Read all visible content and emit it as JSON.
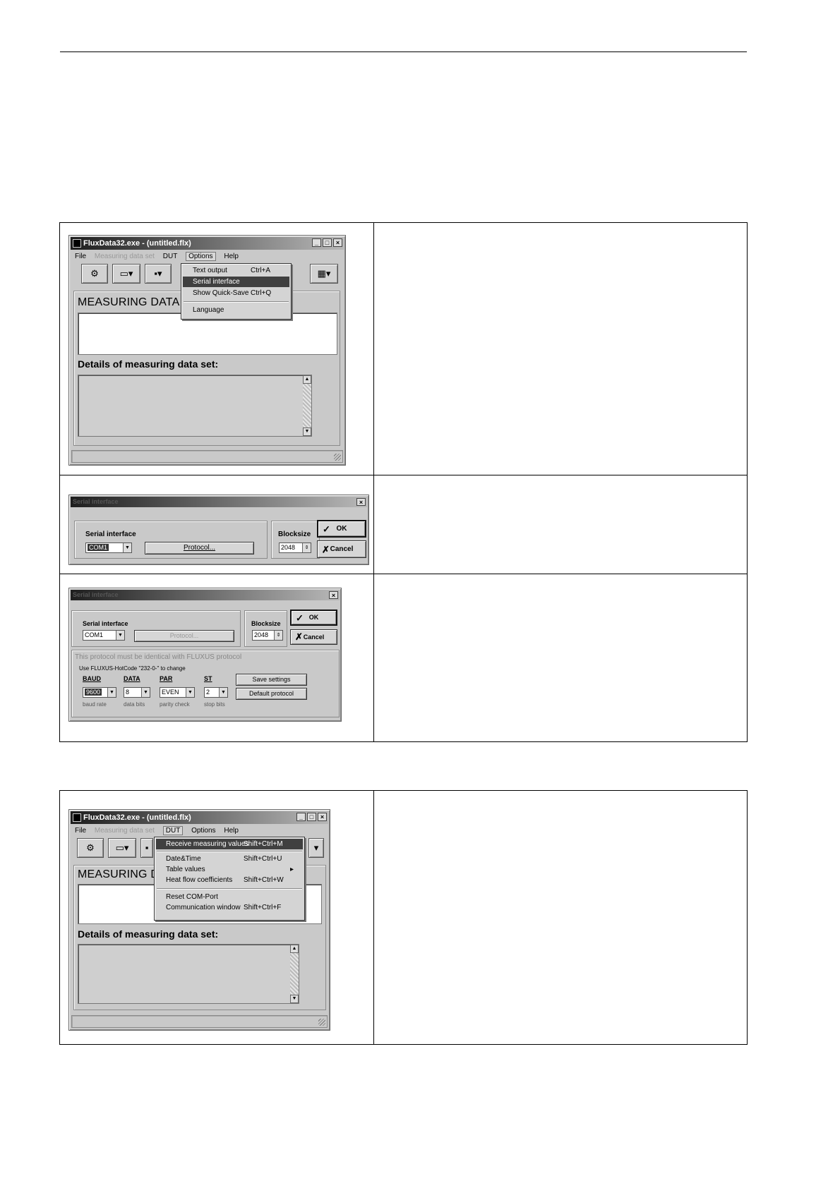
{
  "app1": {
    "title": "FluxData32.exe - (untitled.flx)",
    "menu": [
      "File",
      "Measuring data set",
      "DUT",
      "Options",
      "Help"
    ],
    "options_menu": [
      {
        "label": "Text output",
        "shortcut": "Ctrl+A"
      },
      {
        "label": "Serial interface",
        "shortcut": ""
      },
      {
        "label": "Show Quick-Save",
        "shortcut": "Ctrl+Q"
      },
      {
        "label": "Language",
        "shortcut": ""
      }
    ],
    "measuring_title": "MEASURING DATA S",
    "details_title": "Details of measuring data set:"
  },
  "serial1": {
    "title": "Serial interface",
    "group_label": "Serial interface",
    "port": "COM1",
    "protocol_button": "Protocol...",
    "blocksize_label": "Blocksize",
    "blocksize_value": "2048",
    "ok": "OK",
    "cancel": "Cancel"
  },
  "serial2": {
    "title": "Serial interface",
    "group_label": "Serial interface",
    "port": "COM1",
    "protocol_button": "Protocol...",
    "blocksize_label": "Blocksize",
    "blocksize_value": "2048",
    "ok": "OK",
    "cancel": "Cancel",
    "protocol_note": "This protocol must be identical with FLUXUS protocol",
    "hotcode_note": "Use FLUXUS-HotCode \"232-0-\" to change",
    "fields": [
      {
        "label": "BAUD",
        "value": "9600",
        "caption": "baud rate"
      },
      {
        "label": "DATA",
        "value": "8",
        "caption": "data bits"
      },
      {
        "label": "PAR",
        "value": "EVEN",
        "caption": "parity check"
      },
      {
        "label": "ST",
        "value": "2",
        "caption": "stop bits"
      }
    ],
    "save_button": "Save settings",
    "default_button": "Default protocol"
  },
  "app2": {
    "title": "FluxData32.exe - (untitled.flx)",
    "menu": [
      "File",
      "Measuring data set",
      "DUT",
      "Options",
      "Help"
    ],
    "dut_menu": [
      {
        "label": "Receive measuring values",
        "shortcut": "Shift+Ctrl+M"
      },
      {
        "label": "Date&Time",
        "shortcut": "Shift+Ctrl+U"
      },
      {
        "label": "Table values",
        "shortcut": "▸"
      },
      {
        "label": "Heat flow coefficients",
        "shortcut": "Shift+Ctrl+W"
      },
      {
        "label": "Reset COM-Port",
        "shortcut": ""
      },
      {
        "label": "Communication window",
        "shortcut": "Shift+Ctrl+F"
      }
    ],
    "measuring_title": "MEASURING DA",
    "details_title": "Details of measuring data set:"
  }
}
